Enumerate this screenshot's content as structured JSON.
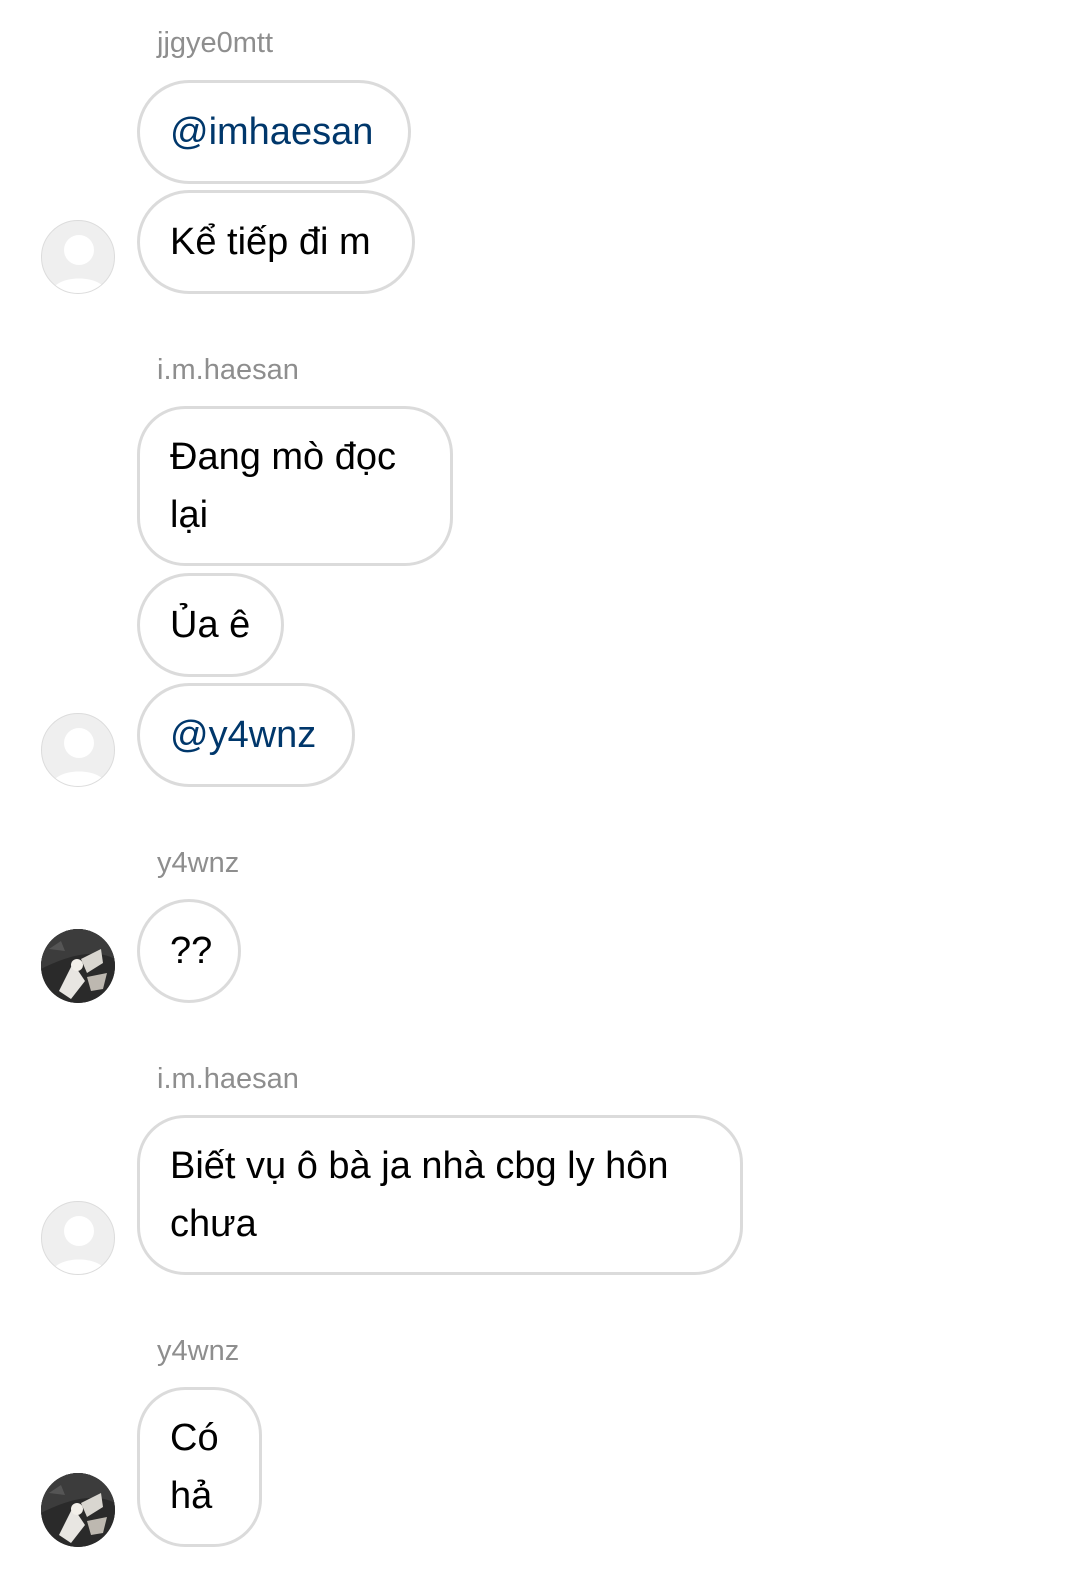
{
  "thread": {
    "groups": [
      {
        "sender": "jjgye0mtt",
        "messages": [
          "@imhaesan",
          "Kể tiếp đi m"
        ]
      },
      {
        "sender": "i.m.haesan",
        "messages": [
          "Đang mò đọc",
          "lại",
          "Ủa ê",
          "@y4wnz"
        ]
      },
      {
        "sender": "y4wnz",
        "messages": [
          "??"
        ]
      },
      {
        "sender": "i.m.haesan",
        "messages": [
          "Biết vụ ô bà ja nhà cbg ly hôn",
          "chưa"
        ]
      },
      {
        "sender": "y4wnz",
        "messages": [
          "Có",
          "hả"
        ]
      }
    ]
  },
  "colors": {
    "mention": "#00376b",
    "sender_name": "#8e8e8e",
    "bubble_border": "#dbdbdb"
  },
  "icons": {
    "default_avatar": "default-avatar-icon",
    "photo_avatar": "profile-photo"
  }
}
